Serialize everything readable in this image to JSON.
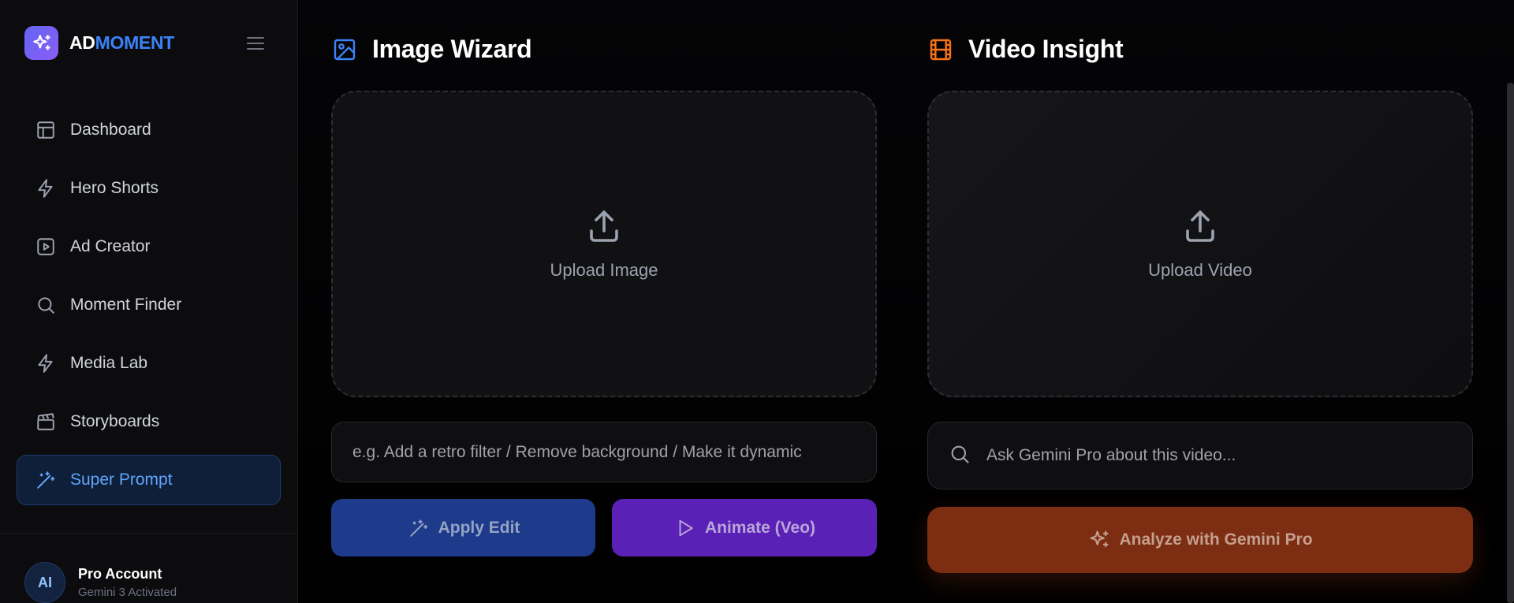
{
  "brand": {
    "name_part1": "AD",
    "name_part2": "MOMENT",
    "logo_icon": "sparkles-icon"
  },
  "sidebar": {
    "toggle_icon": "menu-icon",
    "items": [
      {
        "label": "Dashboard",
        "icon": "layout-icon",
        "active": false
      },
      {
        "label": "Hero Shorts",
        "icon": "bolt-icon",
        "active": false
      },
      {
        "label": "Ad Creator",
        "icon": "play-square-icon",
        "active": false
      },
      {
        "label": "Moment Finder",
        "icon": "search-icon",
        "active": false
      },
      {
        "label": "Media Lab",
        "icon": "bolt-icon",
        "active": false
      },
      {
        "label": "Storyboards",
        "icon": "clapperboard-icon",
        "active": false
      },
      {
        "label": "Super Prompt",
        "icon": "magic-wand-icon",
        "active": true
      }
    ],
    "account": {
      "initials": "AI",
      "name": "Pro Account",
      "status": "Gemini 3 Activated"
    }
  },
  "image_wizard": {
    "title": "Image Wizard",
    "title_icon": "image-icon",
    "upload_label": "Upload Image",
    "prompt_placeholder": "e.g. Add a retro filter / Remove background / Make it dynamic",
    "prompt_value": "",
    "apply_button": "Apply Edit",
    "animate_button": "Animate (Veo)"
  },
  "video_insight": {
    "title": "Video Insight",
    "title_icon": "film-icon",
    "upload_label": "Upload Video",
    "search_placeholder": "Ask Gemini Pro about this video...",
    "search_value": "",
    "analyze_button": "Analyze with Gemini Pro"
  },
  "colors": {
    "accent_blue": "#3b82f6",
    "accent_orange": "#f97316",
    "apply_bg": "#1e3a8a",
    "animate_bg": "#5b21b6",
    "analyze_bg": "#7c2d12"
  }
}
